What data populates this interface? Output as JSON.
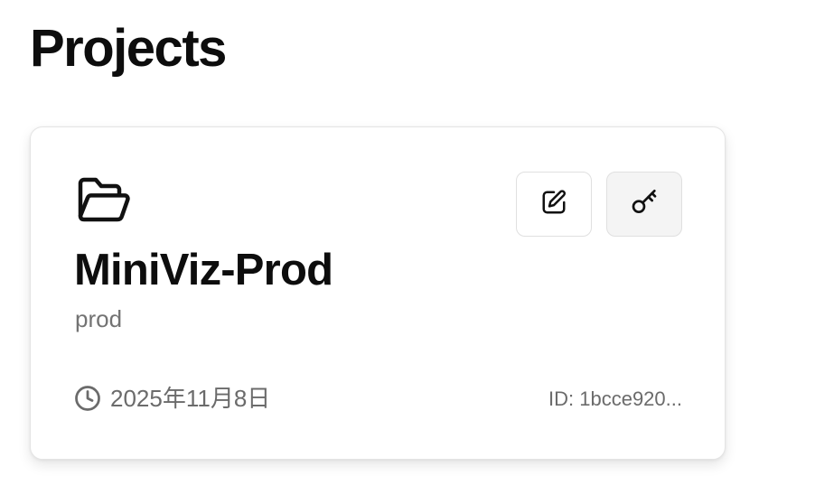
{
  "page": {
    "title": "Projects"
  },
  "project_card": {
    "name": "MiniViz-Prod",
    "subtitle": "prod",
    "created_date": "2025年11月8日",
    "id_label": "ID: 1bcce920...",
    "icons": {
      "project": "folder-open-icon",
      "edit": "edit-icon",
      "keys": "key-icon",
      "date": "clock-icon"
    }
  },
  "colors": {
    "text_primary": "#0d0d0d",
    "text_muted": "#6b6b6b",
    "card_border": "#e4e4e4",
    "key_button_bg": "#f4f4f4"
  }
}
